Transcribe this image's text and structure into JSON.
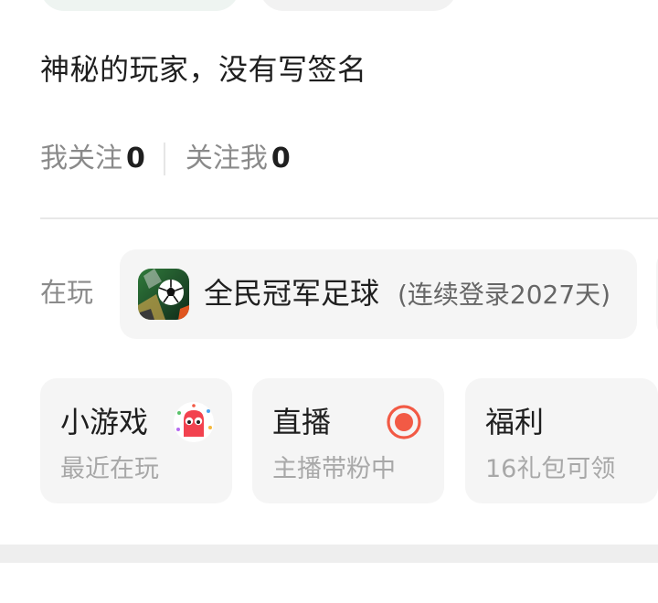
{
  "profile": {
    "signature": "神秘的玩家，没有写签名",
    "following_label": "我关注",
    "following_count": "0",
    "followers_label": "关注我",
    "followers_count": "0"
  },
  "playing": {
    "label": "在玩",
    "game_title": "全民冠军足球",
    "game_sub": "(连续登录2027天)",
    "icon": "soccer-game-icon"
  },
  "tiles": [
    {
      "title": "小游戏",
      "sub": "最近在玩",
      "icon": "mini-game-mascot-icon"
    },
    {
      "title": "直播",
      "sub": "主播带粉中",
      "icon": "live-record-icon"
    },
    {
      "title": "福利",
      "sub": "16礼包可领",
      "icon": ""
    }
  ],
  "colors": {
    "accent_live": "#f25a45",
    "mascot": "#f2424f",
    "muted_text": "#8a8a8a",
    "card_bg": "#f5f5f5"
  }
}
